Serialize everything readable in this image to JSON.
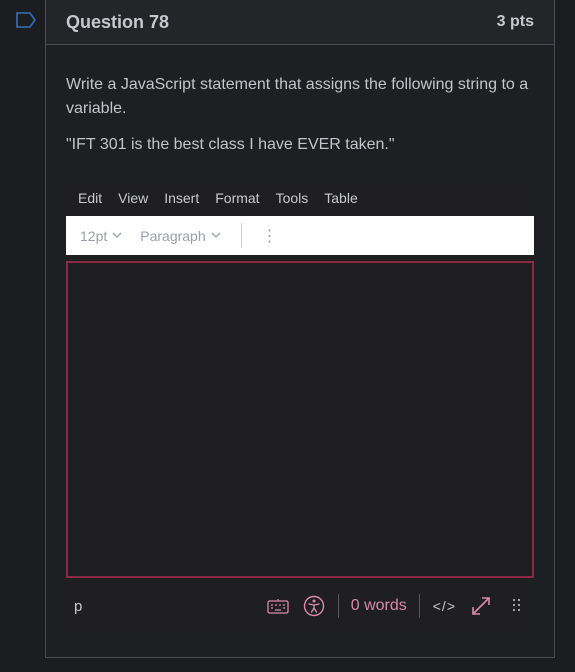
{
  "question": {
    "title": "Question 78",
    "points": "3 pts",
    "prompt": "Write a JavaScript statement that assigns the following string to a variable.",
    "quote": "\"IFT 301 is the best class I have EVER taken.\""
  },
  "editor": {
    "menu": [
      "Edit",
      "View",
      "Insert",
      "Format",
      "Tools",
      "Table"
    ],
    "font_size": "12pt",
    "block_format": "Paragraph",
    "more_label": "⋮",
    "path": "p",
    "word_count": "0 words",
    "code_label": "</>"
  },
  "icons": {
    "flag": "flag-icon",
    "keyboard": "keyboard-icon",
    "accessibility": "accessibility-icon",
    "fullscreen": "fullscreen-icon",
    "resize": "resize-handle-icon"
  },
  "colors": {
    "accent_border": "#8c2a45",
    "accent_text": "#d98ba4",
    "flag": "#3c6fb4"
  }
}
